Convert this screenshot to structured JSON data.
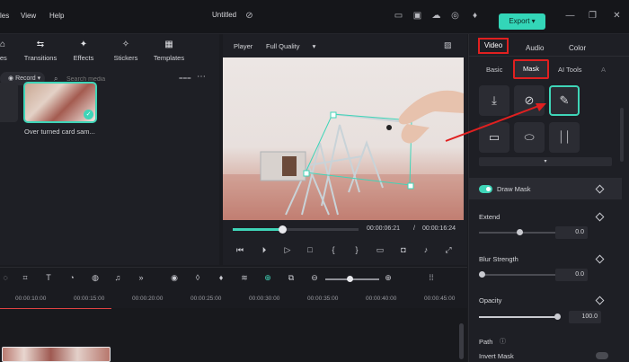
{
  "menu": {
    "items": [
      "les",
      "View",
      "Help"
    ]
  },
  "window": {
    "title": "Untitled",
    "export_label": "Export"
  },
  "media": {
    "tabs": [
      {
        "label": "les",
        "icon": "folder-icon"
      },
      {
        "label": "Transitions",
        "icon": "transitions-icon"
      },
      {
        "label": "Effects",
        "icon": "effects-icon"
      },
      {
        "label": "Stickers",
        "icon": "stickers-icon"
      },
      {
        "label": "Templates",
        "icon": "templates-icon"
      }
    ],
    "record_label": "Record",
    "search_placeholder": "Search media",
    "item_name": "Over turned card sam..."
  },
  "player": {
    "label": "Player",
    "quality": "Full Quality",
    "current_time": "00:00:06:21",
    "separator": "/",
    "total_time": "00:00:16:24",
    "progress": 0.4
  },
  "panel": {
    "tabs": [
      "Video",
      "Audio",
      "Color"
    ],
    "active_tab": "Video",
    "subtabs": [
      "Basic",
      "Mask",
      "AI Tools",
      "A"
    ],
    "active_subtab": "Mask",
    "draw_mask_label": "Draw Mask",
    "extend": {
      "label": "Extend",
      "value": "0.0",
      "level": 0.5
    },
    "blur": {
      "label": "Blur Strength",
      "value": "0.0",
      "level": 0.0
    },
    "opacity": {
      "label": "Opacity",
      "value": "100.0",
      "level": 1.0
    },
    "path_label": "Path",
    "invert_label": "Invert Mask"
  },
  "timeline": {
    "ticks": [
      "00:00:10:00",
      "00:00:15:00",
      "00:00:20:00",
      "00:00:25:00",
      "00:00:30:00",
      "00:00:35:00",
      "00:00:40:00",
      "00:00:45:00"
    ]
  },
  "colors": {
    "accent": "#3fd5b8",
    "highlight": "#e02020",
    "background": "#1a1b20"
  }
}
